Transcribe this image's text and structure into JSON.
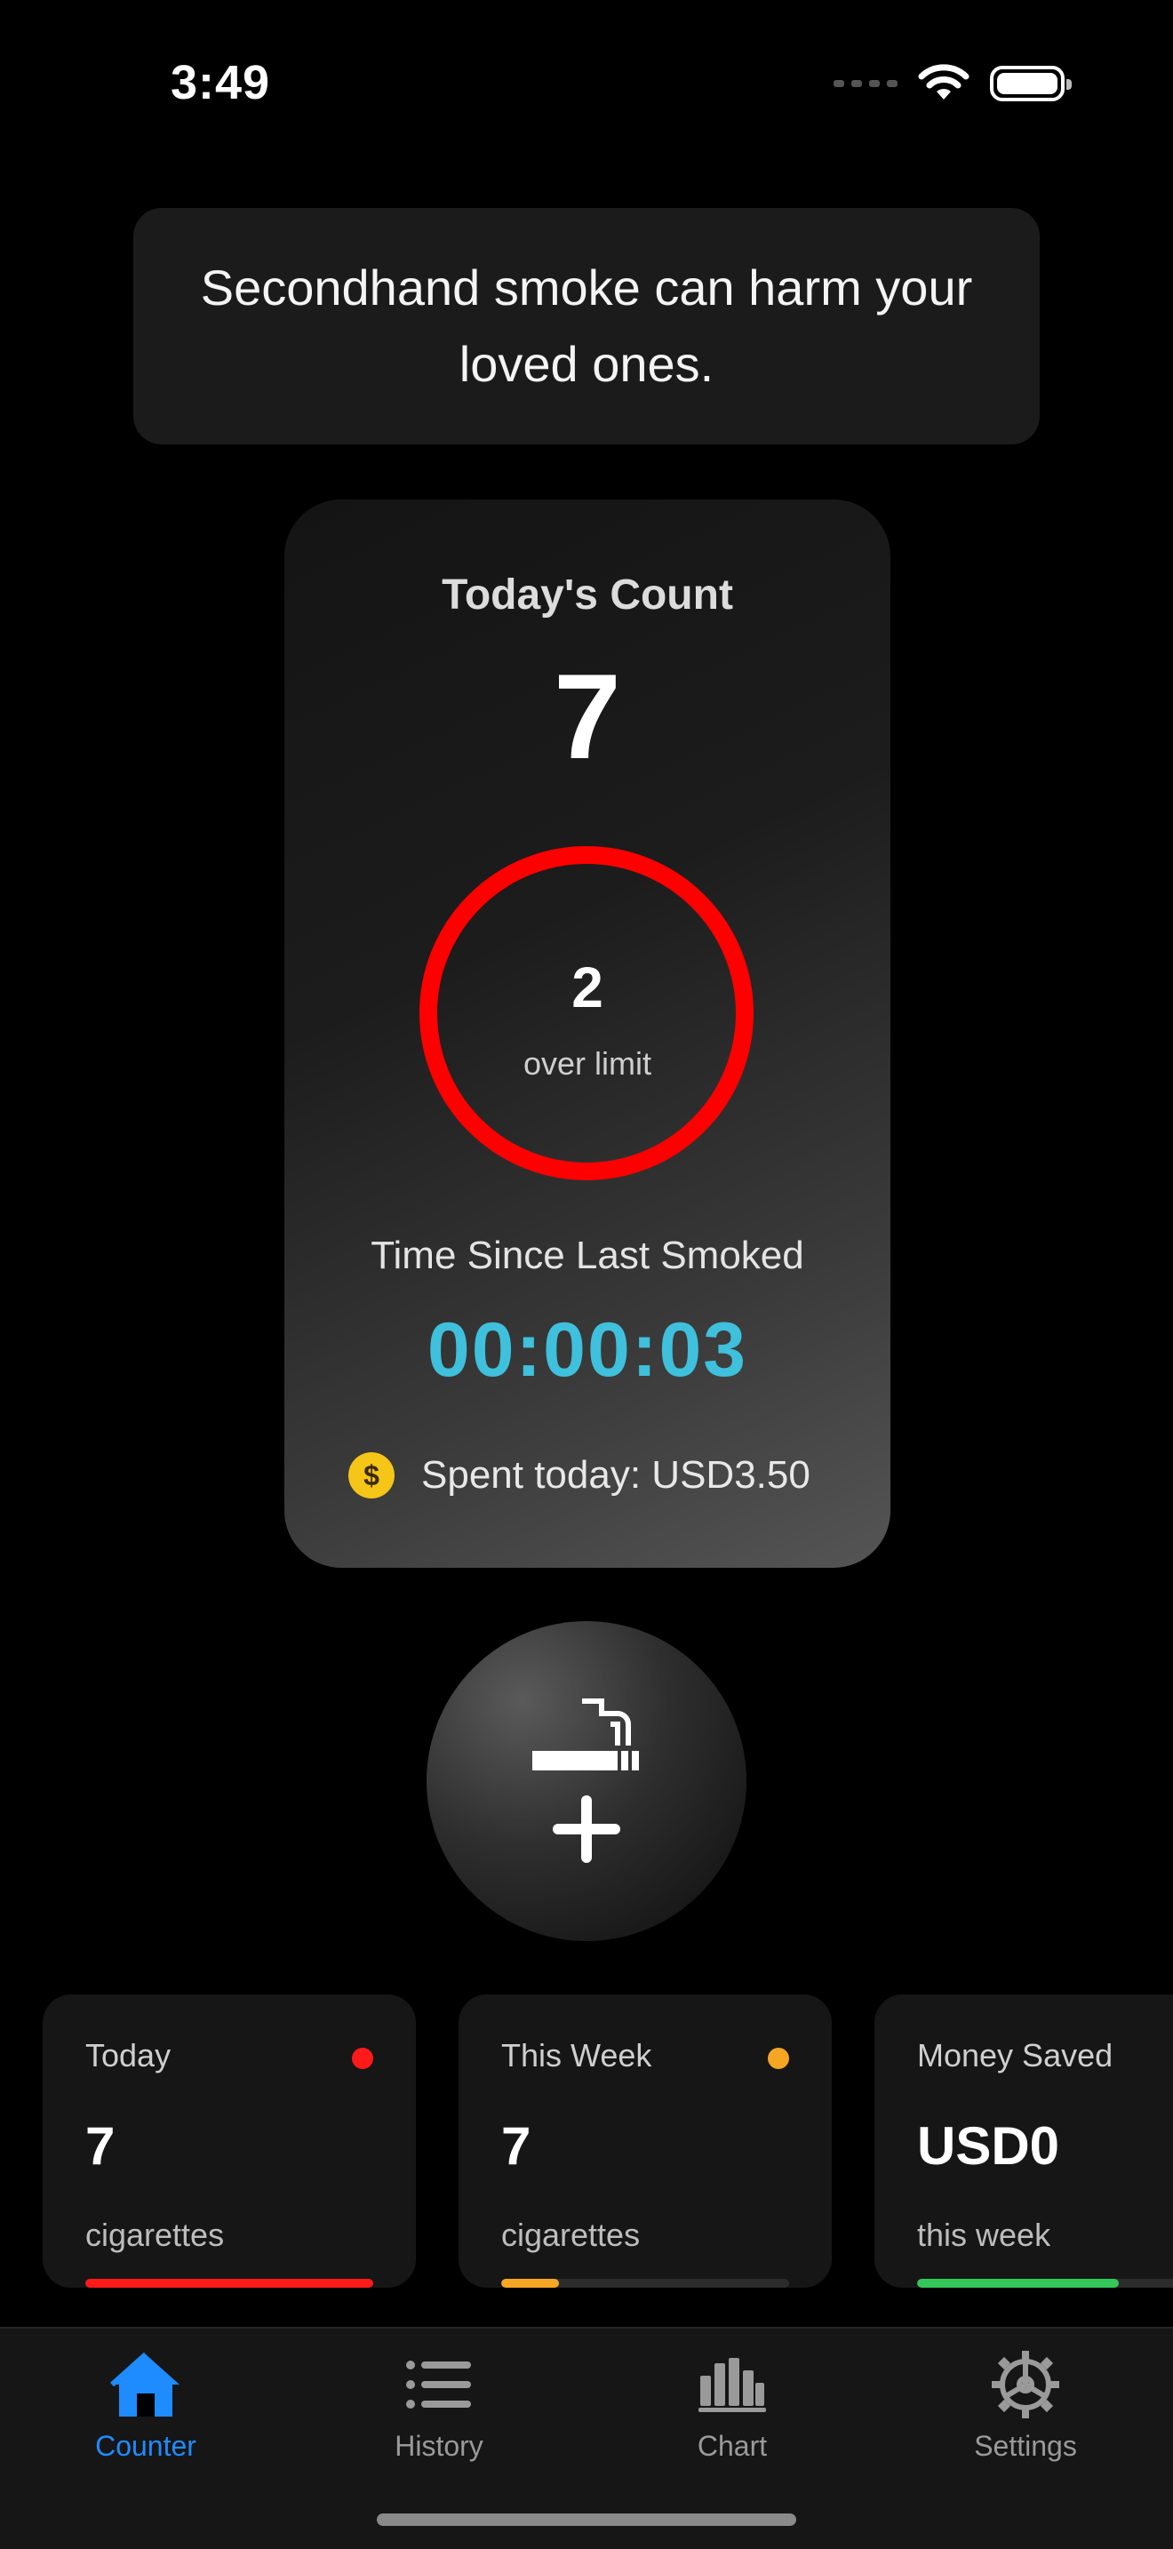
{
  "status_bar": {
    "time": "3:49"
  },
  "tip": {
    "text": "Secondhand smoke can harm your loved ones."
  },
  "counter": {
    "title": "Today's Count",
    "count": "7",
    "ring_value": "2",
    "ring_label": "over limit",
    "ring_color": "#ff0000",
    "since_label": "Time Since Last Smoked",
    "since_timer": "00:00:03",
    "spent_text": "Spent today: USD3.50",
    "coin_symbol": "$"
  },
  "add_button": {
    "icon": "cigarette-plus-icon"
  },
  "stats": [
    {
      "label": "Today",
      "value": "7",
      "unit": "cigarettes",
      "dot_color": "#ff1a1a",
      "bar_color": "#ff1a1a",
      "progress": 1.0
    },
    {
      "label": "This Week",
      "value": "7",
      "unit": "cigarettes",
      "dot_color": "#f5a623",
      "bar_color": "#f5a623",
      "progress": 0.2
    },
    {
      "label": "Money Saved",
      "value": "USD0",
      "unit": "this week",
      "dot_color": "",
      "bar_color": "#34c759",
      "progress": 0.7
    }
  ],
  "tabs": [
    {
      "label": "Counter",
      "icon": "house-icon",
      "active": true
    },
    {
      "label": "History",
      "icon": "list-icon",
      "active": false
    },
    {
      "label": "Chart",
      "icon": "bar-chart-icon",
      "active": false
    },
    {
      "label": "Settings",
      "icon": "gear-icon",
      "active": false
    }
  ],
  "colors": {
    "accent": "#1e8bff",
    "inactive": "#9a9a9a",
    "timer": "#3fc0dc"
  }
}
